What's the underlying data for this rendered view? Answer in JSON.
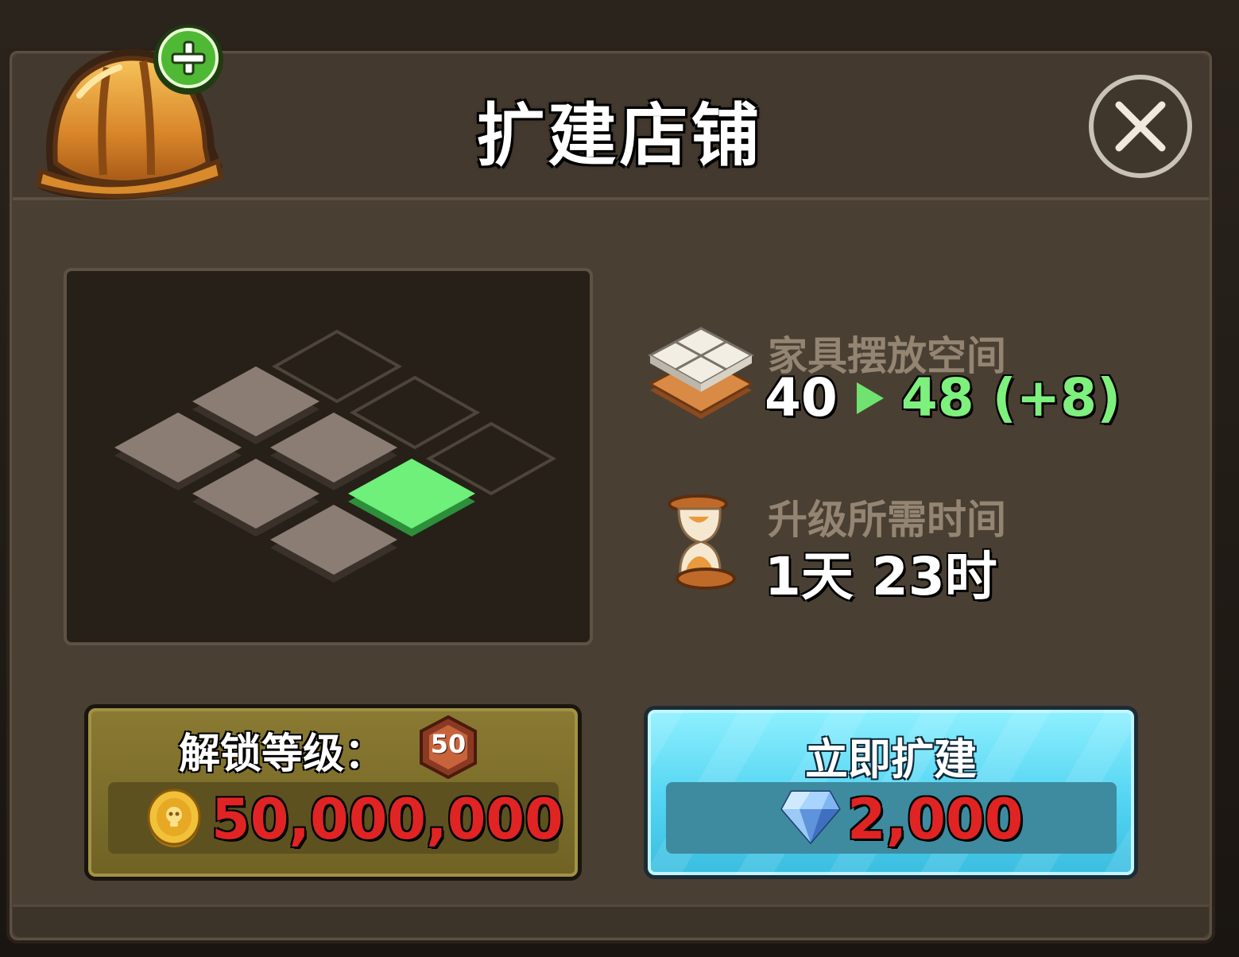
{
  "dialog": {
    "title": "扩建店铺",
    "close_icon": "close-x-icon",
    "header_icon": "hard-hat-plus-icon"
  },
  "preview": {
    "tiles_existing": 6,
    "tiles_new_locked": 3,
    "tiles_new_highlight": 1,
    "highlight_color": "#6ef07a"
  },
  "furniture_space": {
    "icon": "floor-tiles-icon",
    "label": "家具摆放空间",
    "current": "40",
    "next": "48",
    "increase": "(+8)"
  },
  "upgrade_time": {
    "icon": "hourglass-icon",
    "label": "升级所需时间",
    "value": "1天 23时"
  },
  "unlock": {
    "label": "解锁等级：",
    "level": "50",
    "coin_icon": "gold-coin-icon",
    "cost": "50,000,000"
  },
  "expand_now": {
    "label": "立即扩建",
    "gem_icon": "diamond-icon",
    "cost": "2,000"
  },
  "colors": {
    "panel": "#4a3f33",
    "button_blue": "#52d4f2",
    "button_gold": "#8a7a32",
    "price_red": "#e02424",
    "gain_green": "#7ef07e"
  }
}
